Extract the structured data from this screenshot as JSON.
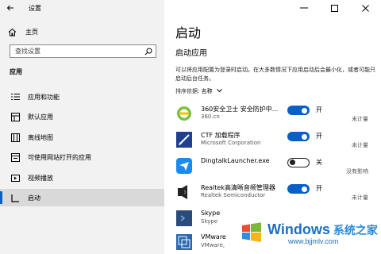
{
  "window": {
    "title": "设置",
    "back_icon": "arrow-left-icon",
    "controls": [
      "minimize-icon",
      "maximize-icon",
      "close-icon"
    ]
  },
  "sidebar": {
    "home_label": "主页",
    "search_placeholder": "查找设置",
    "section_label": "应用",
    "items": [
      {
        "label": "应用和功能",
        "icon": "apps-list-icon"
      },
      {
        "label": "默认应用",
        "icon": "default-apps-icon"
      },
      {
        "label": "离线地图",
        "icon": "offline-maps-icon"
      },
      {
        "label": "可使用网站打开的应用",
        "icon": "website-apps-icon"
      },
      {
        "label": "视频播放",
        "icon": "video-playback-icon"
      },
      {
        "label": "启动",
        "icon": "startup-icon",
        "active": true
      }
    ]
  },
  "main": {
    "title": "启动",
    "subtitle": "启动应用",
    "description": "可以将应用配置为登录时启动。在大多数情况下应用启动后会最小化，或者可能只启动后台任务。",
    "sort_label": "排序依据:",
    "sort_value": "名称",
    "apps": [
      {
        "name": "360安全卫士 安全防护中...",
        "publisher": "360.cn",
        "enabled": true,
        "state": "开",
        "impact": "未计量",
        "icon": "360-security-icon"
      },
      {
        "name": "CTF 加载程序",
        "publisher": "Microsoft Corporation",
        "enabled": true,
        "state": "开",
        "impact": "未计量",
        "icon": "ctf-loader-icon"
      },
      {
        "name": "DingtalkLauncher.exe",
        "publisher": "",
        "enabled": false,
        "state": "关",
        "impact": "没有影响",
        "icon": "dingtalk-icon"
      },
      {
        "name": "Realtek高清晰音频管理器",
        "publisher": "Realtek Semiconductor",
        "enabled": true,
        "state": "开",
        "impact": "未计量",
        "icon": "realtek-audio-icon"
      },
      {
        "name": "Skype",
        "publisher": "Skype",
        "enabled": false,
        "state": "",
        "impact": "",
        "icon": "skype-icon"
      },
      {
        "name": "VMware",
        "publisher": "VMware,",
        "enabled": false,
        "state": "",
        "impact": "",
        "icon": "vmware-icon"
      }
    ]
  },
  "watermark": {
    "brand": "Windows",
    "brand_cn": "系统之家",
    "url": "www.bjjmlv.com"
  },
  "colors": {
    "accent": "#0a5fc5",
    "sidebar_bg": "#f2f2f2",
    "active_bg": "#d9d9d9"
  }
}
